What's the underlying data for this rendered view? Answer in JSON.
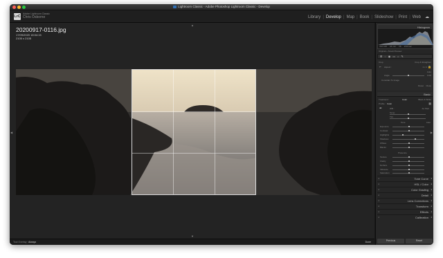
{
  "window": {
    "title": "Lightroom Classic - Adobe Photoshop Lightroom Classic - Develop",
    "traffic_colors": [
      "#fe5f57",
      "#febc2e",
      "#28c840"
    ]
  },
  "identity": {
    "logo": "LrC",
    "line1": "Adobe Lightroom Classic",
    "line2": "Chris Osborne"
  },
  "modules": {
    "items": [
      "Library",
      "Develop",
      "Map",
      "Book",
      "Slideshow",
      "Print",
      "Web"
    ],
    "active": "Develop"
  },
  "photo_info": {
    "filename": "20200917-0116.jpg",
    "datetime": "17/09/2020 18:04:15",
    "dimensions": "2105 x 2105"
  },
  "histogram": {
    "title": "Histogram",
    "meta": [
      "ISO 100",
      "24 mm",
      "f/8",
      "1/50 sec"
    ],
    "original": "Original + Smart Preview"
  },
  "crop_panel": {
    "title": "Crop & Straighten",
    "aspect_label": "Aspect :",
    "aspect_value": "1 x 1",
    "auto": "Auto",
    "angle_label": "Angle",
    "angle_value": "0.00",
    "constrain": "Constrain To Image",
    "reset": "Reset",
    "close": "Close"
  },
  "basic_panel": {
    "title": "Basic",
    "treatment_label": "Treatment :",
    "treatment_color": "Color",
    "treatment_bw": "Black & White",
    "profile_label": "Profile :",
    "profile_value": "Color",
    "wb_label": "WB :",
    "wb_value": "As Shot",
    "temp": "Temp",
    "tint": "Tint",
    "tone": "Tone",
    "tone_auto": "Auto",
    "sliders": [
      "Exposure",
      "Contrast",
      "Highlights",
      "Shadows",
      "Whites",
      "Blacks"
    ],
    "presence": "Presence",
    "presence_sliders": [
      "Texture",
      "Clarity",
      "Dehaze",
      "Vibrance",
      "Saturation"
    ]
  },
  "panels": [
    "Tone Curve",
    "HSL / Color",
    "Color Grading",
    "Detail",
    "Lens Corrections",
    "Transform",
    "Effects",
    "Calibration"
  ],
  "toolbar": {
    "tool_label": "Tool Overlay :",
    "tool_value": "Always",
    "done": "Done"
  },
  "buttons": {
    "previous": "Previous",
    "reset": "Reset"
  }
}
